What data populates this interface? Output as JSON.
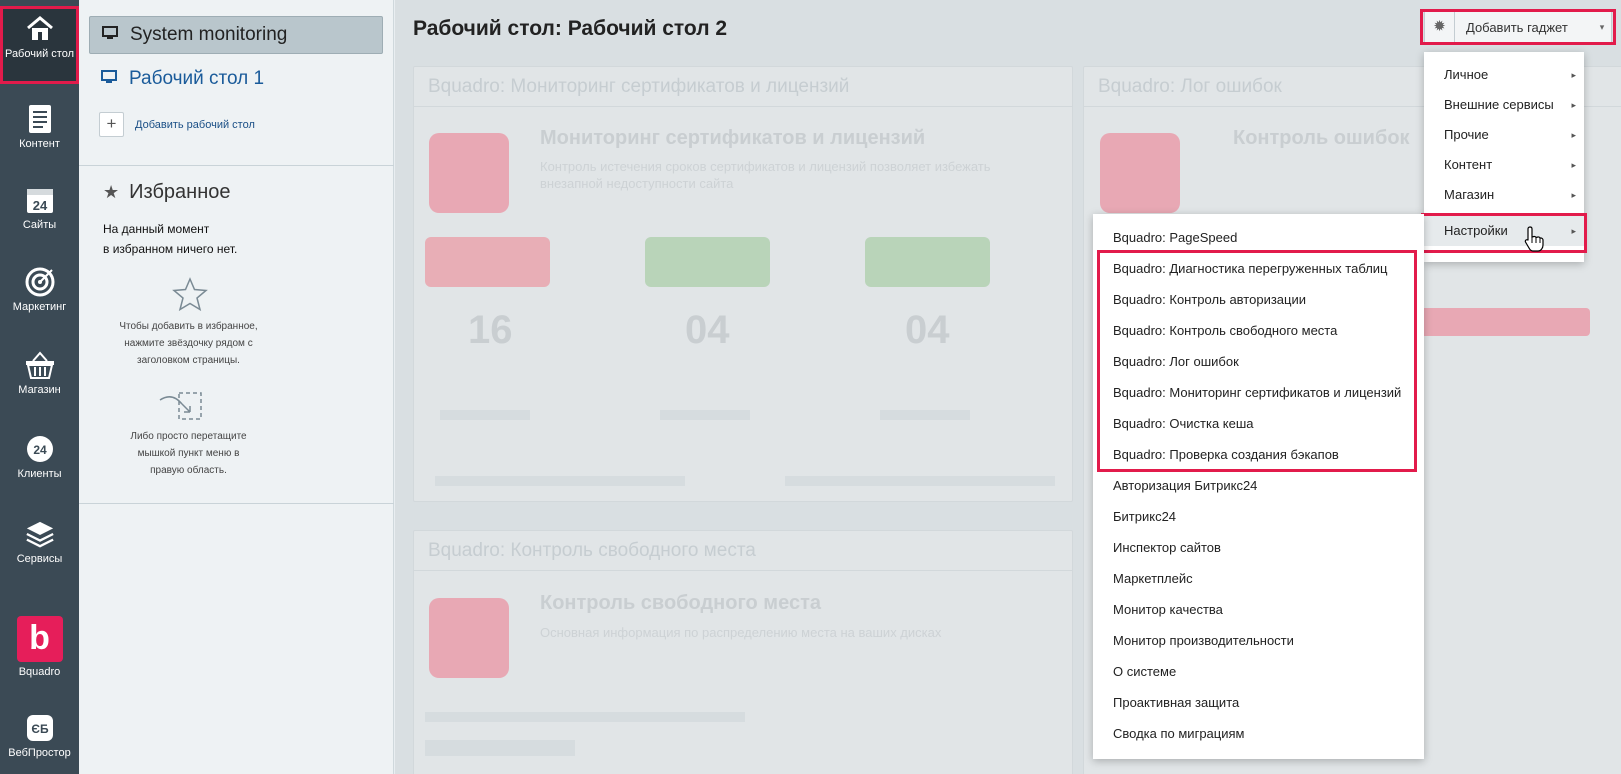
{
  "nav": {
    "items": [
      {
        "label": "Рабочий стол",
        "icon": "home-icon"
      },
      {
        "label": "Контент",
        "icon": "document-icon"
      },
      {
        "label": "Сайты",
        "icon": "calendar-24-icon"
      },
      {
        "label": "Маркетинг",
        "icon": "target-icon"
      },
      {
        "label": "Магазин",
        "icon": "basket-icon"
      },
      {
        "label": "Клиенты",
        "icon": "clients-24-icon"
      },
      {
        "label": "Сервисы",
        "icon": "layers-icon"
      },
      {
        "label": "Bquadro",
        "icon": "bquadro-logo"
      },
      {
        "label": "ВебПростор",
        "icon": "webprostor-icon"
      }
    ],
    "bquadro_letter": "b"
  },
  "panel": {
    "active_desktop": "System monitoring",
    "desktop_link": "Рабочий стол 1",
    "add_desktop": "Добавить рабочий стол",
    "add_symbol": "+",
    "favorites_title": "Избранное",
    "favorites_empty_line1": "На данный момент",
    "favorites_empty_line2": "в избранном ничего нет.",
    "hint_star_1": "Чтобы добавить в избранное,",
    "hint_star_2": "нажмите звёздочку рядом с",
    "hint_star_3": "заголовком страницы.",
    "hint_drag_1": "Либо просто перетащите",
    "hint_drag_2": "мышкой пункт меню в",
    "hint_drag_3": "правую область."
  },
  "main": {
    "title": "Рабочий стол: Рабочий стол 2",
    "add_gadget": "Добавить гаджет",
    "gadget1_head": "Bquadro: Мониторинг сертификатов и лицензий",
    "gadget1_title": "Мониторинг сертификатов и лицензий",
    "gadget1_text": "Контроль истечения сроков сертификатов и лицензий позволяет избежать внезапной недоступности сайта",
    "gadget1_nums": [
      "16",
      "04",
      "04"
    ],
    "gadget2_head": "Bquadro: Лог ошибок",
    "gadget2_title": "Контроль ошибок",
    "gadget3_head": "Bquadro: Контроль свободного места",
    "gadget3_title": "Контроль свободного места",
    "gadget3_text": "Основная информация по распределению места на ваших дисках"
  },
  "menu1": {
    "items": [
      "Личное",
      "Внешние сервисы",
      "Прочие",
      "Контент",
      "Магазин",
      "Настройки"
    ],
    "selected": "Настройки",
    "arrow": "▸"
  },
  "menu2": {
    "items": [
      "Bquadro: PageSpeed",
      "Bquadro: Диагностика перегруженных таблиц",
      "Bquadro: Контроль авторизации",
      "Bquadro: Контроль свободного места",
      "Bquadro: Лог ошибок",
      "Bquadro: Мониторинг сертификатов и лицензий",
      "Bquadro: Очистка кеша",
      "Bquadro: Проверка создания бэкапов",
      "Авторизация Битрикс24",
      "Битрикс24",
      "Инспектор сайтов",
      "Маркетплейс",
      "Монитор качества",
      "Монитор производительности",
      "О системе",
      "Проактивная защита",
      "Сводка по миграциям"
    ]
  }
}
